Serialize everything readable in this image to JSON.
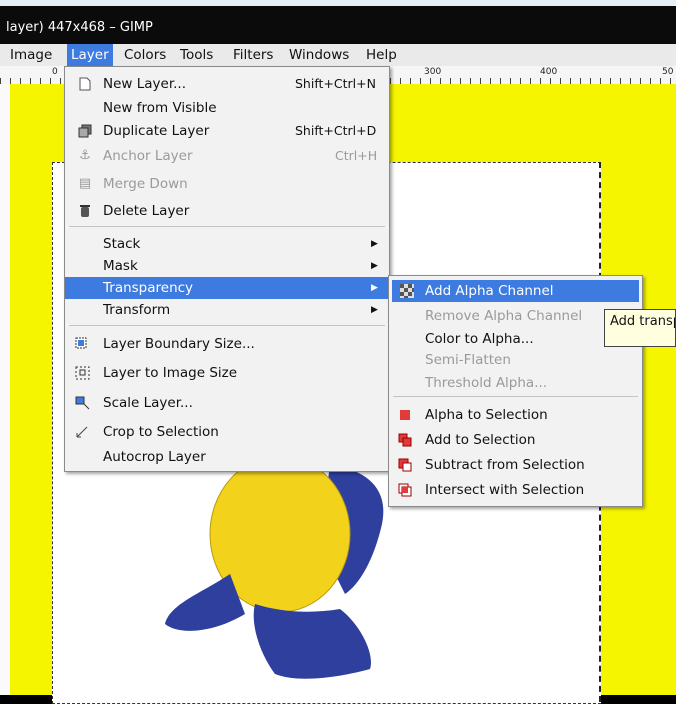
{
  "window": {
    "title": "layer) 447x468 – GIMP"
  },
  "menubar": {
    "items": [
      "Image",
      "Layer",
      "Colors",
      "Tools",
      "Filters",
      "Windows",
      "Help"
    ]
  },
  "ruler": {
    "labels": [
      "0",
      "300",
      "400",
      "50"
    ]
  },
  "layer_menu": {
    "new_layer": {
      "label": "New Layer...",
      "shortcut": "Shift+Ctrl+N"
    },
    "new_from_visible": {
      "label": "New from Visible"
    },
    "duplicate_layer": {
      "label": "Duplicate Layer",
      "shortcut": "Shift+Ctrl+D"
    },
    "anchor_layer": {
      "label": "Anchor Layer",
      "shortcut": "Ctrl+H"
    },
    "merge_down": {
      "label": "Merge Down"
    },
    "delete_layer": {
      "label": "Delete Layer"
    },
    "stack": {
      "label": "Stack"
    },
    "mask": {
      "label": "Mask"
    },
    "transparency": {
      "label": "Transparency"
    },
    "transform": {
      "label": "Transform"
    },
    "layer_boundary_size": {
      "label": "Layer Boundary Size..."
    },
    "layer_to_image_size": {
      "label": "Layer to Image Size"
    },
    "scale_layer": {
      "label": "Scale Layer..."
    },
    "crop_to_selection": {
      "label": "Crop to Selection"
    },
    "autocrop_layer": {
      "label": "Autocrop Layer"
    }
  },
  "transparency_menu": {
    "add_alpha": "Add Alpha Channel",
    "remove_alpha": "Remove Alpha Channel",
    "color_to_alpha": "Color to Alpha...",
    "semi_flatten": "Semi-Flatten",
    "threshold_alpha": "Threshold Alpha...",
    "alpha_to_selection": "Alpha to Selection",
    "add_to_selection": "Add to Selection",
    "subtract_from_selection": "Subtract from Selection",
    "intersect_with_selection": "Intersect with Selection"
  },
  "tooltip": {
    "text": "Add transp"
  },
  "colors": {
    "canvas_bg": "#f5f500",
    "highlight": "#3d7be0",
    "duck_body": "#f2d21a",
    "duck_feet": "#2e3f9e"
  }
}
